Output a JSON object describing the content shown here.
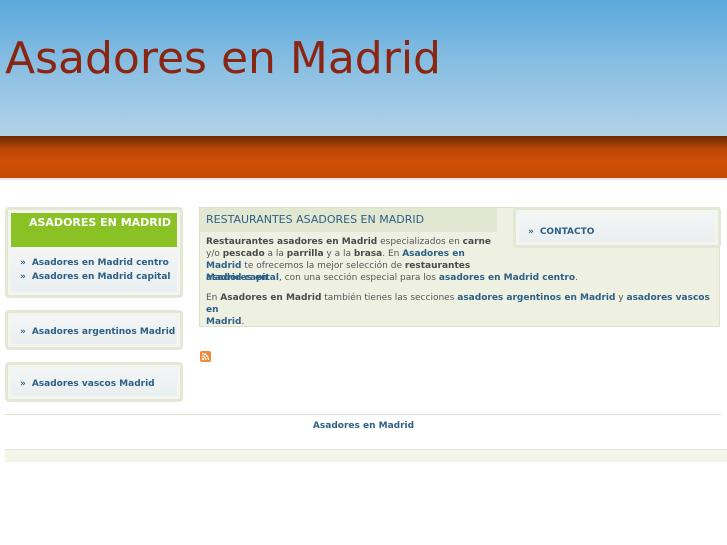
{
  "site": {
    "title": "Asadores en Madrid"
  },
  "sidebar": {
    "box1": {
      "heading": "ASADORES EN MADRID",
      "items": [
        {
          "label": "Asadores en Madrid centro"
        },
        {
          "label": "Asadores en Madrid capital"
        }
      ]
    },
    "box2": {
      "items": [
        {
          "label": "Asadores argentinos Madrid"
        }
      ]
    },
    "box3": {
      "items": [
        {
          "label": "Asadores vascos Madrid"
        }
      ]
    }
  },
  "contact": {
    "items": [
      {
        "label": "CONTACTO"
      }
    ]
  },
  "main": {
    "heading": "RESTAURANTES ASADORES EN MADRID",
    "p1": {
      "t1": "Restaurantes asadores en Madrid",
      "t2": " especializados en ",
      "t3": "carne",
      "t4": " y/o ",
      "t5": "pescado",
      "t6": " a la ",
      "t7": "parrilla",
      "t8": " y a la ",
      "t9": "brasa",
      "t10": ". En ",
      "t11": "Asadores en Madrid",
      "t12": " te ofrecemos la mejor selección de ",
      "t13": "restaurantes",
      "t14": " ",
      "t15": "asadores en"
    },
    "p1b": {
      "t1": "Madrid capital",
      "t2": ", con una sección especial para los ",
      "t3": "asadores en Madrid centro",
      "t4": "."
    },
    "p2": {
      "t1": "En ",
      "t2": "Asadores en Madrid",
      "t3": " también tienes las secciones ",
      "t4": "asadores argentinos en Madrid",
      "t5": " y ",
      "t6": "asadores vascos en",
      "t7": " ",
      "t8": "Madrid",
      "t9": "."
    }
  },
  "footer": {
    "link": "Asadores en Madrid"
  },
  "icons": {
    "rss": "rss-feed-icon",
    "bullet": "»"
  },
  "colors": {
    "title": "#8a2512",
    "band": "#d14f05",
    "accent_green": "#8ac225",
    "link": "#2d5f86"
  }
}
